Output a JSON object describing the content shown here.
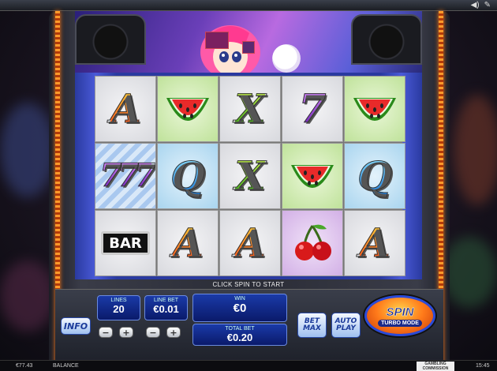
{
  "topbar": {
    "icons": [
      "speaker-icon",
      "wrench-icon"
    ],
    "glyphs": {
      "speaker": "◀)",
      "wrench": "✎"
    }
  },
  "reels": [
    [
      {
        "sym": "A",
        "bg": "plain"
      },
      {
        "sym": "watermelon",
        "bg": "green"
      },
      {
        "sym": "X",
        "bg": "plain"
      },
      {
        "sym": "7",
        "bg": "plain"
      },
      {
        "sym": "watermelon",
        "bg": "green"
      }
    ],
    [
      {
        "sym": "777",
        "bg": "stripe"
      },
      {
        "sym": "Q",
        "bg": "blue"
      },
      {
        "sym": "X",
        "bg": "plain"
      },
      {
        "sym": "watermelon",
        "bg": "green"
      },
      {
        "sym": "Q",
        "bg": "blue"
      }
    ],
    [
      {
        "sym": "BAR",
        "bg": "plain"
      },
      {
        "sym": "A",
        "bg": "plain"
      },
      {
        "sym": "A",
        "bg": "plain"
      },
      {
        "sym": "cherry",
        "bg": "purple"
      },
      {
        "sym": "A",
        "bg": "plain"
      }
    ]
  ],
  "status_text": "CLICK SPIN TO START",
  "controls": {
    "info": "INFO",
    "lines_label": "LINES",
    "lines_value": "20",
    "linebet_label": "LINE BET",
    "linebet_value": "€0.01",
    "win_label": "WIN",
    "win_value": "€0",
    "totalbet_label": "TOTAL BET",
    "totalbet_value": "€0.20",
    "minus": "−",
    "plus": "+",
    "betmax_line1": "BET",
    "betmax_line2": "MAX",
    "autoplay_line1": "AUTO",
    "autoplay_line2": "PLAY",
    "spin": "SPIN",
    "turbo": "TURBO MODE"
  },
  "bottombar": {
    "balance_amount": "€77.43",
    "balance_label": "BALANCE",
    "gambling_commission": "GAMBLING COMMISSION",
    "time": "15:45"
  }
}
